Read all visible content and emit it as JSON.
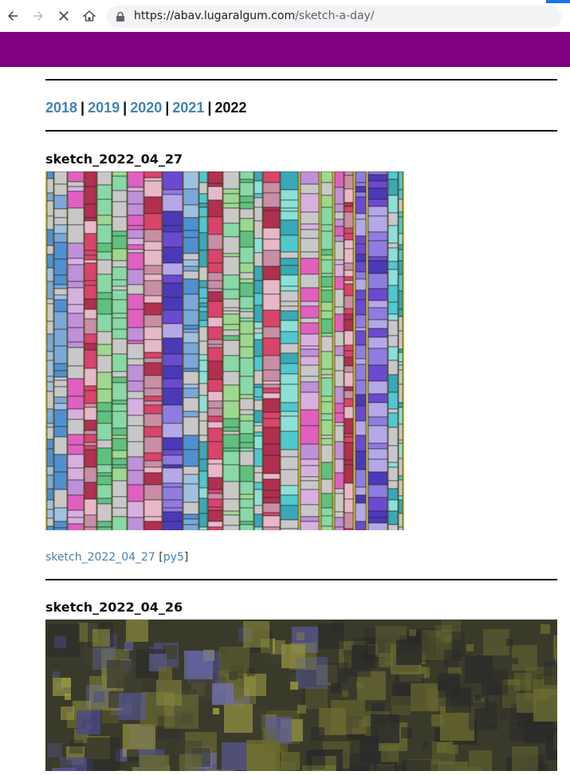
{
  "browser": {
    "url_host": "https://abav.lugaralgum.com",
    "url_path": "/sketch-a-day/"
  },
  "years": {
    "y2018": "2018",
    "y2019": "2019",
    "y2020": "2020",
    "y2021": "2021",
    "current": "2022",
    "separator": "|"
  },
  "sketches": [
    {
      "title": "sketch_2022_04_27",
      "link_label": "sketch_2022_04_27",
      "py5_label": "py5",
      "bracket_open": "[",
      "bracket_close": "]"
    },
    {
      "title": "sketch_2022_04_26"
    }
  ],
  "colors": {
    "header": "#800080",
    "link": "#4682b4"
  }
}
